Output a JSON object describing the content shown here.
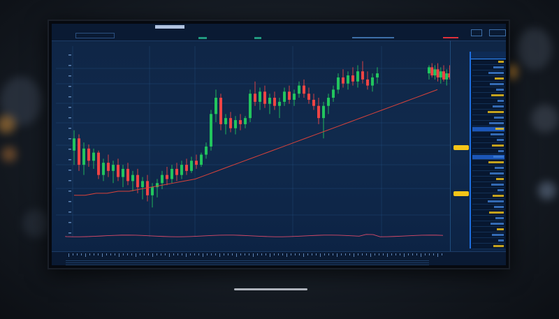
{
  "scene": {
    "description_free": true
  },
  "topbar": {
    "ticker": "",
    "items": [
      "",
      "",
      "",
      "",
      "",
      "",
      "",
      ""
    ],
    "tab_active": ""
  },
  "chart_data": {
    "type": "candlestick",
    "title": "",
    "xlabel": "",
    "ylabel": "",
    "ylim": [
      0,
      100
    ],
    "candles": [
      {
        "o": 62,
        "h": 72,
        "l": 55,
        "c": 68
      },
      {
        "o": 68,
        "h": 70,
        "l": 52,
        "c": 55
      },
      {
        "o": 55,
        "h": 66,
        "l": 50,
        "c": 63
      },
      {
        "o": 63,
        "h": 65,
        "l": 54,
        "c": 57
      },
      {
        "o": 57,
        "h": 63,
        "l": 53,
        "c": 61
      },
      {
        "o": 61,
        "h": 62,
        "l": 48,
        "c": 50
      },
      {
        "o": 50,
        "h": 58,
        "l": 47,
        "c": 56
      },
      {
        "o": 56,
        "h": 60,
        "l": 49,
        "c": 52
      },
      {
        "o": 52,
        "h": 57,
        "l": 46,
        "c": 55
      },
      {
        "o": 55,
        "h": 58,
        "l": 47,
        "c": 49
      },
      {
        "o": 49,
        "h": 55,
        "l": 44,
        "c": 53
      },
      {
        "o": 53,
        "h": 56,
        "l": 45,
        "c": 47
      },
      {
        "o": 47,
        "h": 52,
        "l": 42,
        "c": 50
      },
      {
        "o": 50,
        "h": 53,
        "l": 41,
        "c": 44
      },
      {
        "o": 44,
        "h": 49,
        "l": 38,
        "c": 47
      },
      {
        "o": 47,
        "h": 50,
        "l": 37,
        "c": 40
      },
      {
        "o": 40,
        "h": 46,
        "l": 34,
        "c": 44
      },
      {
        "o": 44,
        "h": 48,
        "l": 39,
        "c": 46
      },
      {
        "o": 46,
        "h": 52,
        "l": 43,
        "c": 50
      },
      {
        "o": 50,
        "h": 54,
        "l": 45,
        "c": 48
      },
      {
        "o": 48,
        "h": 55,
        "l": 46,
        "c": 53
      },
      {
        "o": 53,
        "h": 56,
        "l": 47,
        "c": 50
      },
      {
        "o": 50,
        "h": 57,
        "l": 48,
        "c": 55
      },
      {
        "o": 55,
        "h": 58,
        "l": 50,
        "c": 52
      },
      {
        "o": 52,
        "h": 59,
        "l": 51,
        "c": 57
      },
      {
        "o": 57,
        "h": 60,
        "l": 53,
        "c": 55
      },
      {
        "o": 55,
        "h": 61,
        "l": 54,
        "c": 60
      },
      {
        "o": 60,
        "h": 66,
        "l": 58,
        "c": 64
      },
      {
        "o": 64,
        "h": 82,
        "l": 62,
        "c": 80
      },
      {
        "o": 80,
        "h": 92,
        "l": 76,
        "c": 88
      },
      {
        "o": 88,
        "h": 90,
        "l": 72,
        "c": 75
      },
      {
        "o": 75,
        "h": 80,
        "l": 70,
        "c": 78
      },
      {
        "o": 78,
        "h": 81,
        "l": 71,
        "c": 73
      },
      {
        "o": 73,
        "h": 79,
        "l": 70,
        "c": 77
      },
      {
        "o": 77,
        "h": 80,
        "l": 72,
        "c": 75
      },
      {
        "o": 75,
        "h": 79,
        "l": 73,
        "c": 78
      },
      {
        "o": 78,
        "h": 92,
        "l": 76,
        "c": 90
      },
      {
        "o": 90,
        "h": 96,
        "l": 84,
        "c": 86
      },
      {
        "o": 86,
        "h": 93,
        "l": 82,
        "c": 91
      },
      {
        "o": 91,
        "h": 94,
        "l": 83,
        "c": 85
      },
      {
        "o": 85,
        "h": 90,
        "l": 80,
        "c": 88
      },
      {
        "o": 88,
        "h": 91,
        "l": 82,
        "c": 84
      },
      {
        "o": 84,
        "h": 88,
        "l": 78,
        "c": 86
      },
      {
        "o": 86,
        "h": 93,
        "l": 84,
        "c": 91
      },
      {
        "o": 91,
        "h": 94,
        "l": 85,
        "c": 87
      },
      {
        "o": 87,
        "h": 92,
        "l": 84,
        "c": 90
      },
      {
        "o": 90,
        "h": 96,
        "l": 88,
        "c": 94
      },
      {
        "o": 94,
        "h": 97,
        "l": 88,
        "c": 90
      },
      {
        "o": 90,
        "h": 93,
        "l": 85,
        "c": 87
      },
      {
        "o": 87,
        "h": 90,
        "l": 82,
        "c": 84
      },
      {
        "o": 84,
        "h": 88,
        "l": 75,
        "c": 78
      },
      {
        "o": 78,
        "h": 86,
        "l": 68,
        "c": 84
      },
      {
        "o": 84,
        "h": 90,
        "l": 80,
        "c": 88
      },
      {
        "o": 88,
        "h": 94,
        "l": 86,
        "c": 92
      },
      {
        "o": 92,
        "h": 100,
        "l": 90,
        "c": 98
      },
      {
        "o": 98,
        "h": 102,
        "l": 93,
        "c": 95
      },
      {
        "o": 95,
        "h": 101,
        "l": 92,
        "c": 99
      },
      {
        "o": 99,
        "h": 103,
        "l": 94,
        "c": 96
      },
      {
        "o": 96,
        "h": 104,
        "l": 93,
        "c": 101
      },
      {
        "o": 101,
        "h": 106,
        "l": 95,
        "c": 97
      },
      {
        "o": 97,
        "h": 101,
        "l": 92,
        "c": 94
      },
      {
        "o": 94,
        "h": 100,
        "l": 91,
        "c": 98
      },
      {
        "o": 98,
        "h": 103,
        "l": 95,
        "c": 100
      }
    ],
    "tail_candles": [
      {
        "o": 100,
        "h": 104,
        "l": 97,
        "c": 103
      },
      {
        "o": 103,
        "h": 105,
        "l": 98,
        "c": 99
      },
      {
        "o": 99,
        "h": 104,
        "l": 97,
        "c": 102
      },
      {
        "o": 102,
        "h": 105,
        "l": 96,
        "c": 98
      },
      {
        "o": 98,
        "h": 103,
        "l": 95,
        "c": 101
      },
      {
        "o": 101,
        "h": 104,
        "l": 96,
        "c": 97
      },
      {
        "o": 97,
        "h": 102,
        "l": 94,
        "c": 100
      },
      {
        "o": 100,
        "h": 104,
        "l": 97,
        "c": 98
      }
    ],
    "moving_average": [
      40,
      40,
      41,
      41,
      42,
      42,
      43,
      44,
      45,
      46,
      47,
      48,
      50,
      52,
      54,
      56,
      58,
      60,
      62,
      64,
      66,
      68,
      70,
      72,
      74,
      76,
      78,
      80,
      82,
      84,
      86,
      88,
      90,
      92
    ]
  },
  "axis_labels": {
    "right": [
      "",
      "",
      "",
      "",
      "",
      "",
      "",
      "",
      "",
      "",
      "",
      "",
      "",
      "",
      "",
      "",
      "",
      "",
      "",
      ""
    ]
  },
  "price_tags": [
    "",
    ""
  ],
  "side_panel": {
    "rows": [
      "",
      "",
      "",
      "",
      "",
      "",
      "",
      "",
      "",
      "",
      "",
      "",
      "",
      "",
      "",
      "",
      "",
      "",
      "",
      "",
      "",
      "",
      "",
      "",
      "",
      "",
      "",
      "",
      "",
      "",
      "",
      "",
      "",
      ""
    ]
  },
  "bottombar": {
    "labels": [
      "",
      "",
      "",
      "",
      "",
      "",
      "",
      "",
      "",
      "",
      "",
      "",
      "",
      "",
      "",
      "",
      "",
      "",
      "",
      "",
      "",
      "",
      "",
      "",
      ""
    ]
  },
  "colors": {
    "bull": "#22c55e",
    "bear": "#ef4444",
    "ma_line": "#d9423a",
    "accent_blue": "#2f8cff",
    "accent_red": "#e0303a",
    "tag_yellow": "#f5c518",
    "panel_bg": "#071730"
  }
}
